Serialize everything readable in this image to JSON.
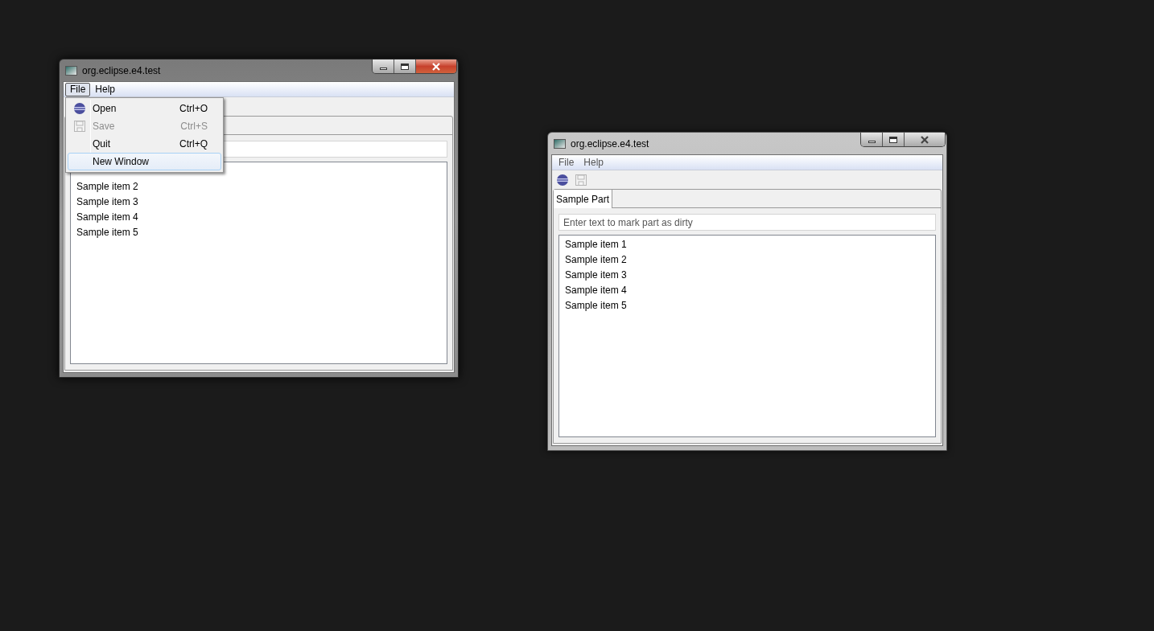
{
  "windows": [
    {
      "title": "org.eclipse.e4.test",
      "active": true,
      "menu_bar": [
        {
          "label": "File",
          "selected": true
        },
        {
          "label": "Help",
          "selected": false
        }
      ],
      "open_menu": [
        {
          "label": "Open",
          "shortcut": "Ctrl+O",
          "kind": "open",
          "disabled": false,
          "selected": false
        },
        {
          "label": "Save",
          "shortcut": "Ctrl+S",
          "kind": "save",
          "disabled": true,
          "selected": false
        },
        {
          "label": "Quit",
          "shortcut": "Ctrl+Q",
          "kind": "none",
          "disabled": false,
          "selected": false
        },
        {
          "label": "New Window",
          "kind": "none",
          "disabled": false,
          "selected": true
        }
      ],
      "list_items": [
        "Sample item 2",
        "Sample item 3",
        "Sample item 4",
        "Sample item 5"
      ]
    },
    {
      "title": "org.eclipse.e4.test",
      "active": false,
      "menu_bar": [
        {
          "label": "File",
          "selected": false
        },
        {
          "label": "Help",
          "selected": false
        }
      ],
      "toolbar": [
        {
          "kind": "open",
          "disabled": false
        },
        {
          "kind": "save",
          "disabled": true
        }
      ],
      "tabs": [
        {
          "label": "Sample Part",
          "selected": true
        }
      ],
      "field": {
        "placeholder": "Enter text to mark part as dirty"
      },
      "list_items": [
        "Sample item 1",
        "Sample item 2",
        "Sample item 3",
        "Sample item 4",
        "Sample item 5"
      ]
    }
  ]
}
